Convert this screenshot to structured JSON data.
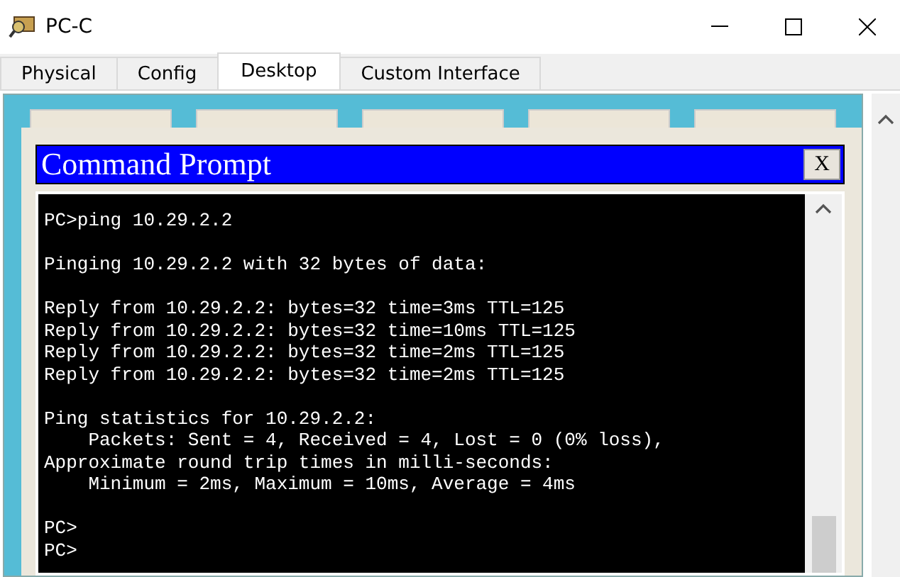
{
  "window": {
    "title": "PC-C"
  },
  "tabs": [
    {
      "label": "Physical",
      "selected": false
    },
    {
      "label": "Config",
      "selected": false
    },
    {
      "label": "Desktop",
      "selected": true
    },
    {
      "label": "Custom Interface",
      "selected": false
    }
  ],
  "dialog": {
    "title": "Command Prompt",
    "close_label": "X"
  },
  "terminal": {
    "blocks": [
      [
        "PC>ping 10.29.2.2"
      ],
      [
        "Pinging 10.29.2.2 with 32 bytes of data:"
      ],
      [
        "Reply from 10.29.2.2: bytes=32 time=3ms TTL=125",
        "Reply from 10.29.2.2: bytes=32 time=10ms TTL=125",
        "Reply from 10.29.2.2: bytes=32 time=2ms TTL=125",
        "Reply from 10.29.2.2: bytes=32 time=2ms TTL=125"
      ],
      [
        "Ping statistics for 10.29.2.2:",
        "    Packets: Sent = 4, Received = 4, Lost = 0 (0% loss),",
        "Approximate round trip times in milli-seconds:",
        "    Minimum = 2ms, Maximum = 10ms, Average = 4ms"
      ],
      [
        "PC>",
        "PC>"
      ]
    ]
  }
}
